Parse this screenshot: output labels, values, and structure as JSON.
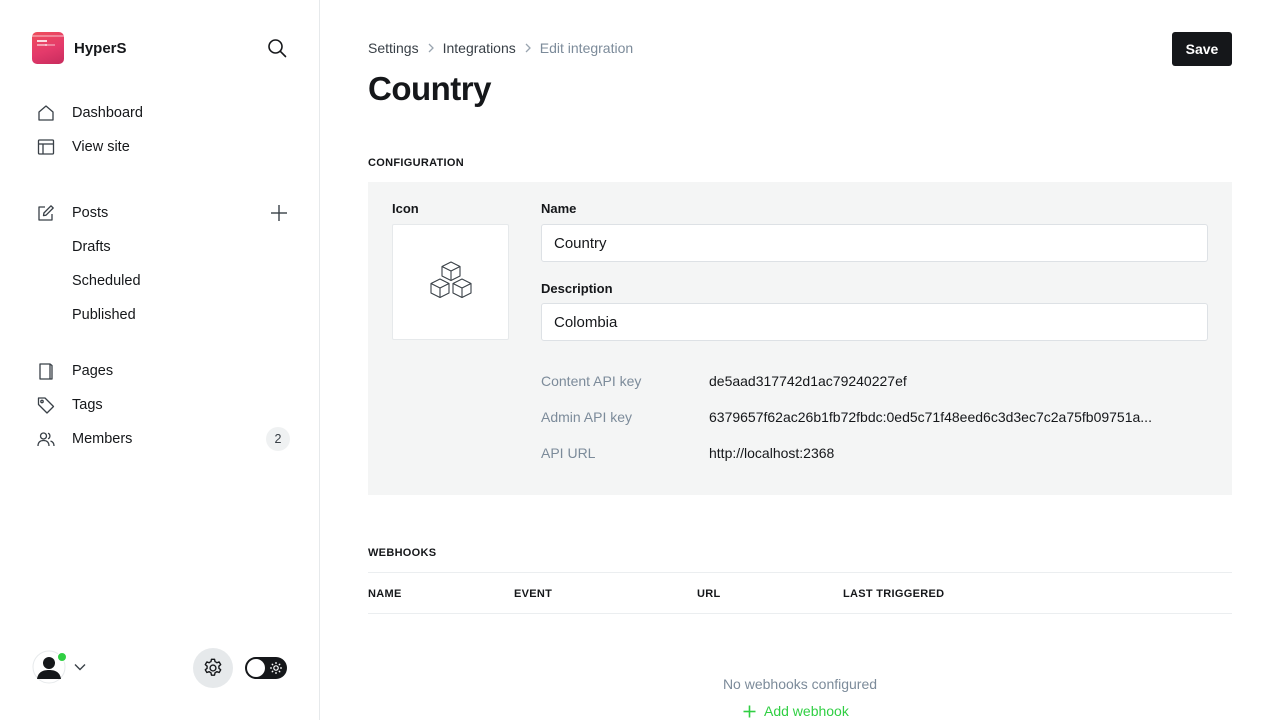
{
  "brand": {
    "name": "HyperS"
  },
  "sidebar": {
    "nav_primary": [
      {
        "label": "Dashboard",
        "icon": "home-icon"
      },
      {
        "label": "View site",
        "icon": "layout-icon"
      }
    ],
    "posts": {
      "label": "Posts",
      "icon": "edit-icon",
      "sub": [
        "Drafts",
        "Scheduled",
        "Published"
      ]
    },
    "nav_secondary": [
      {
        "label": "Pages",
        "icon": "page-icon"
      },
      {
        "label": "Tags",
        "icon": "tag-icon"
      },
      {
        "label": "Members",
        "icon": "members-icon",
        "count": "2"
      }
    ]
  },
  "breadcrumb": {
    "items": [
      "Settings",
      "Integrations"
    ],
    "current": "Edit integration"
  },
  "header": {
    "title": "Country",
    "save_label": "Save"
  },
  "configuration": {
    "section_label": "CONFIGURATION",
    "icon_label": "Icon",
    "name_label": "Name",
    "name_value": "Country",
    "description_label": "Description",
    "description_value": "Colombia",
    "content_api_key_label": "Content API key",
    "content_api_key_value": "de5aad317742d1ac79240227ef",
    "admin_api_key_label": "Admin API key",
    "admin_api_key_value": "6379657f62ac26b1fb72fbdc:0ed5c71f48eed6c3d3ec7c2a75fb09751a...",
    "api_url_label": "API URL",
    "api_url_value": "http://localhost:2368"
  },
  "webhooks": {
    "section_label": "WEBHOOKS",
    "columns": [
      "NAME",
      "EVENT",
      "URL",
      "LAST TRIGGERED"
    ],
    "empty_text": "No webhooks configured",
    "add_label": "Add webhook"
  },
  "colors": {
    "accent_green": "#30cf43",
    "dark": "#15171a",
    "muted": "#7c8b9a",
    "panel_bg": "#f4f5f5",
    "brand_red": "#e43a6b"
  }
}
